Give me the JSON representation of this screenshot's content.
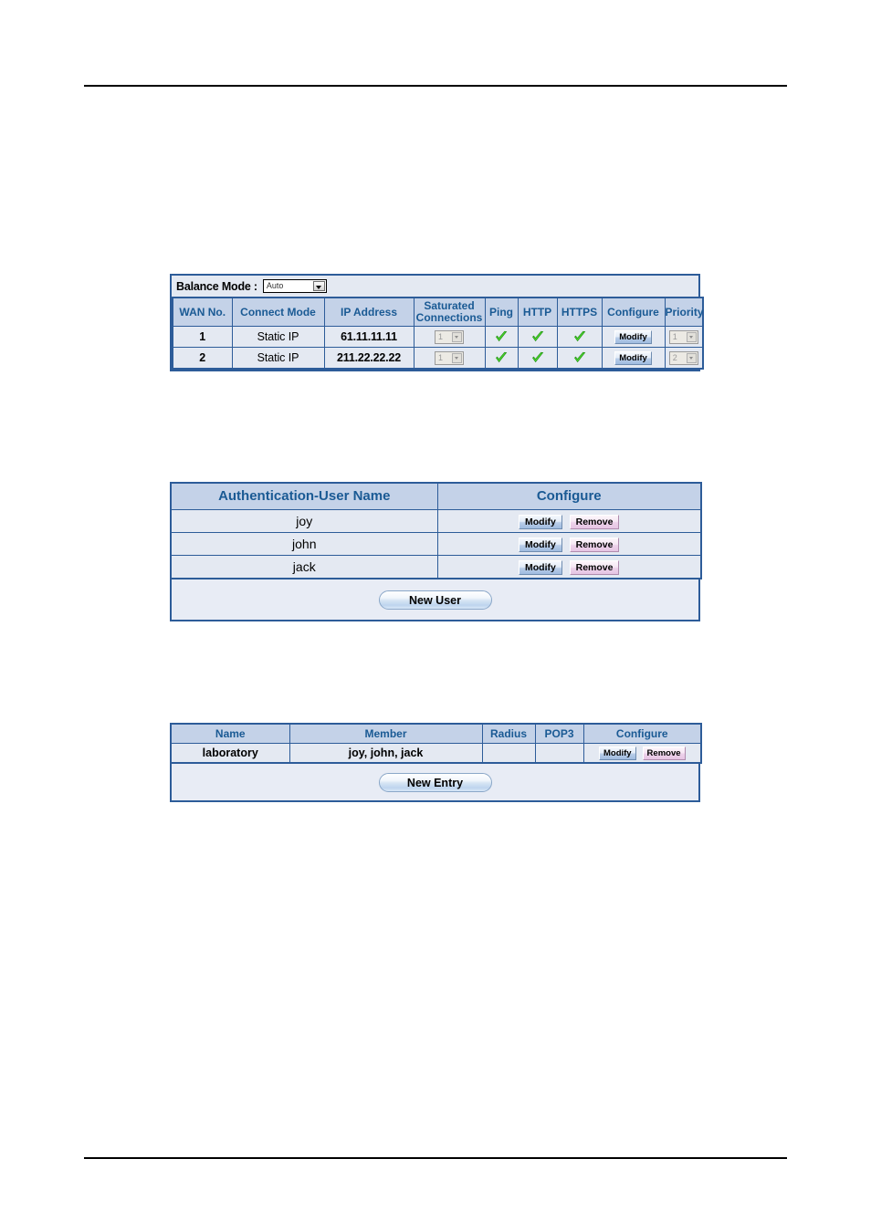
{
  "balance_panel": {
    "balance_mode_label": "Balance Mode :",
    "balance_mode_value": "Auto",
    "wan_table": {
      "columns": [
        "WAN No.",
        "Connect Mode",
        "IP Address",
        "Saturated Connections",
        "Ping",
        "HTTP",
        "HTTPS",
        "Configure",
        "Priority"
      ],
      "saturated_header_line1": "Saturated",
      "saturated_header_line2": "Connections",
      "rows": [
        {
          "wan_no": "1",
          "connect_mode": "Static IP",
          "ip_address": "61.11.11.11",
          "saturated_connections": "1",
          "ping": "check",
          "http": "check",
          "https": "check",
          "configure_label": "Modify",
          "priority": "1"
        },
        {
          "wan_no": "2",
          "connect_mode": "Static IP",
          "ip_address": "211.22.22.22",
          "saturated_connections": "1",
          "ping": "check",
          "http": "check",
          "https": "check",
          "configure_label": "Modify",
          "priority": "2"
        }
      ]
    }
  },
  "auth_panel": {
    "columns": [
      "Authentication-User Name",
      "Configure"
    ],
    "rows": [
      {
        "user_name": "joy",
        "modify_label": "Modify",
        "remove_label": "Remove"
      },
      {
        "user_name": "john",
        "modify_label": "Modify",
        "remove_label": "Remove"
      },
      {
        "user_name": "jack",
        "modify_label": "Modify",
        "remove_label": "Remove"
      }
    ],
    "new_button_label": "New User"
  },
  "group_panel": {
    "columns": [
      "Name",
      "Member",
      "Radius",
      "POP3",
      "Configure"
    ],
    "rows": [
      {
        "name": "laboratory",
        "member": "joy, john, jack",
        "radius": "",
        "pop3": "",
        "modify_label": "Modify",
        "remove_label": "Remove"
      }
    ],
    "new_button_label": "New Entry"
  },
  "colors": {
    "header_bg": "#c4d2e8",
    "header_text": "#1a5a94",
    "row_bg": "#e4e9f2",
    "border": "#2d5c99",
    "footer_bg": "#e8ecf5",
    "check_green": "#3fcc2a",
    "modify_blue": "#b9cde8",
    "remove_pink": "#edd2ea"
  }
}
